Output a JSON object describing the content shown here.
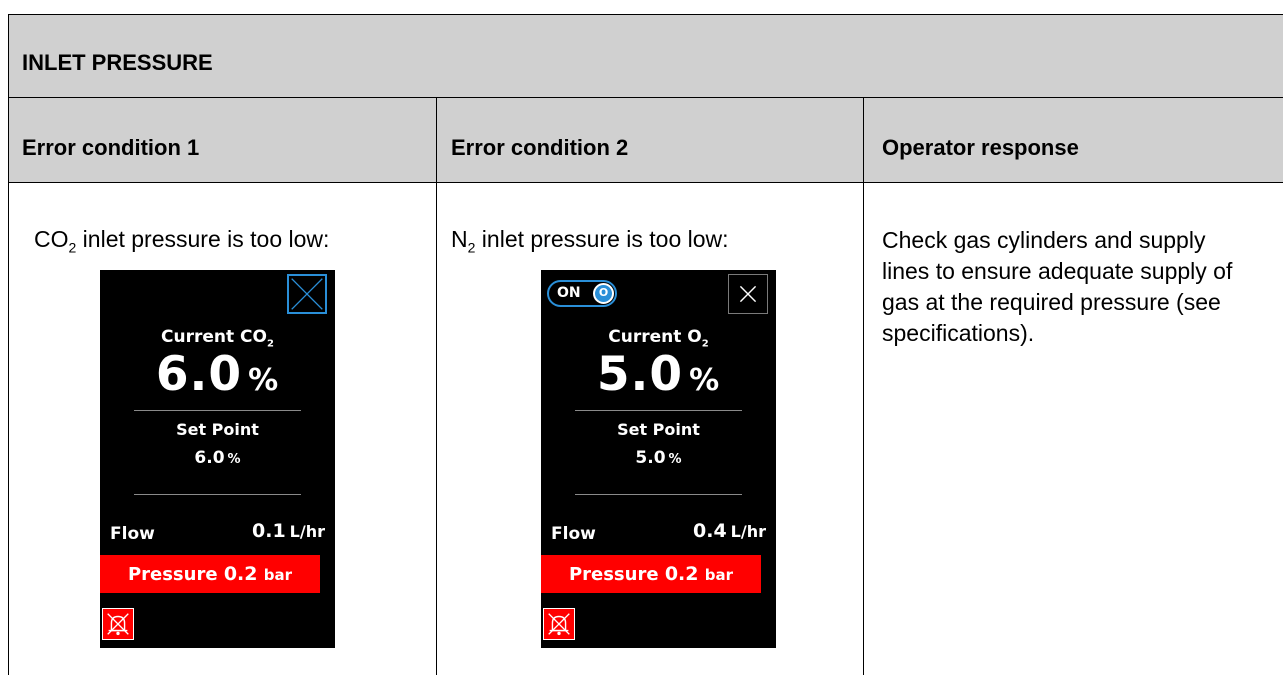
{
  "section": {
    "title": "INLET PRESSURE"
  },
  "columns": [
    {
      "label": "Error condition 1"
    },
    {
      "label": "Error condition 2"
    },
    {
      "label": "Operator response"
    }
  ],
  "condition1": {
    "gas": "CO",
    "gas_sub": "2",
    "text": " inlet pressure is too low:"
  },
  "condition2": {
    "gas": "N",
    "gas_sub": "2",
    "text": " inlet pressure is too low:"
  },
  "response": "Check gas cylinders and supply lines to ensure adequate supply of gas at the required pressure (see specifications).",
  "panel1": {
    "current_label": "Current CO",
    "current_sub": "2",
    "current_value": "6.0",
    "current_unit": "%",
    "setpoint_label": "Set Point",
    "setpoint_value": "6.0",
    "setpoint_unit": "%",
    "flow_label": "Flow",
    "flow_value": "0.1",
    "flow_unit": "L/hr",
    "pressure_label": "Pressure",
    "pressure_value": "0.2",
    "pressure_unit": "bar"
  },
  "panel2": {
    "toggle_label": "ON",
    "toggle_knob": "O",
    "current_label": "Current O",
    "current_sub": "2",
    "current_value": "5.0",
    "current_unit": "%",
    "setpoint_label": "Set Point",
    "setpoint_value": "5.0",
    "setpoint_unit": "%",
    "flow_label": "Flow",
    "flow_value": "0.4",
    "flow_unit": "L/hr",
    "pressure_label": "Pressure",
    "pressure_value": "0.2",
    "pressure_unit": "bar"
  },
  "colors": {
    "header_bg": "#d0d0d0",
    "panel_bg": "#000000",
    "alarm_red": "#ff0000",
    "accent_blue": "#2a8fd8"
  },
  "icons": [
    "close-icon",
    "alarm-mute-icon",
    "oxygen-toggle-icon"
  ]
}
